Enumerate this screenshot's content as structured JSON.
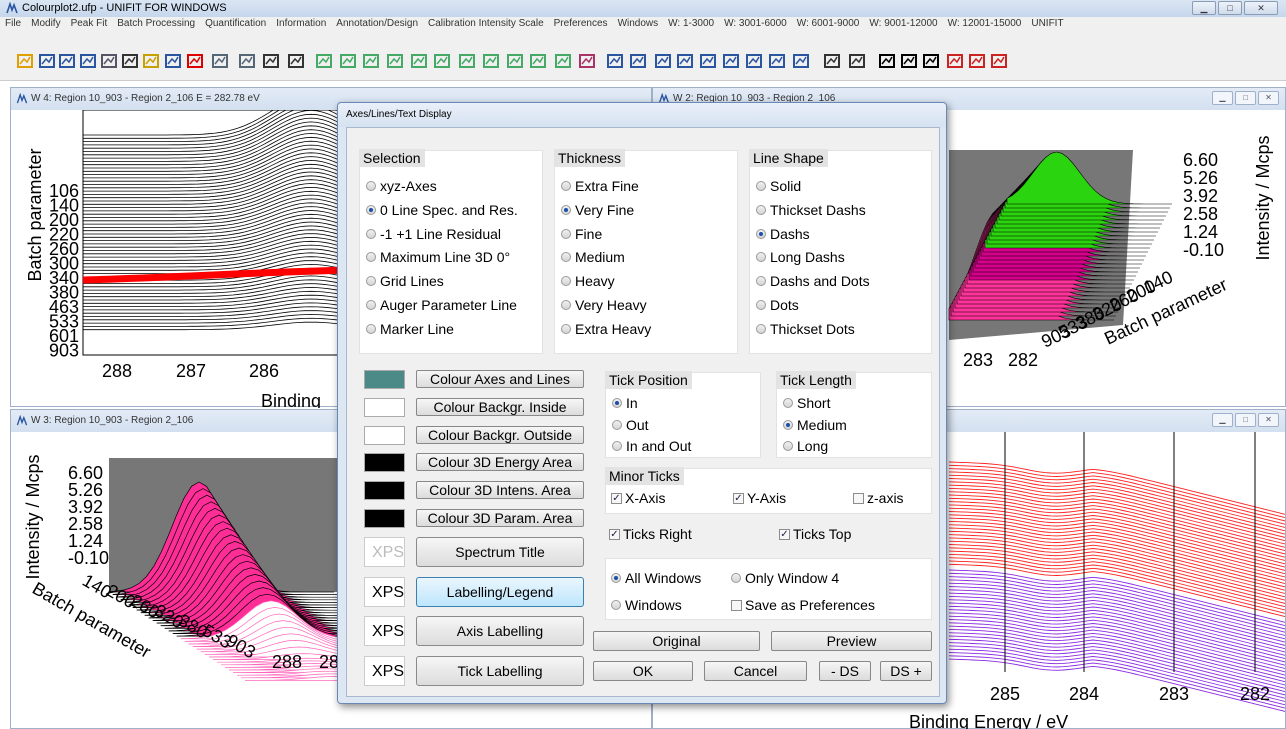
{
  "app": {
    "title": "Colourplot2.ufp - UNIFIT FOR WINDOWS"
  },
  "menu": [
    "File",
    "Modify",
    "Peak Fit",
    "Batch Processing",
    "Quantification",
    "Information",
    "Annotation/Design",
    "Calibration Intensity Scale",
    "Preferences",
    "Windows",
    "W: 1-3000",
    "W: 3001-6000",
    "W: 6001-9000",
    "W: 9001-12000",
    "W: 12001-15000",
    "UNIFIT"
  ],
  "windows": {
    "w4": {
      "title": "W 4: Region 10_903 - Region 2_106  E = 282.78 eV",
      "ylabel": "Batch parameter",
      "xlabel": "Binding",
      "xticks": [
        "288",
        "287",
        "286"
      ],
      "yticks": [
        "106",
        "140",
        "200",
        "220",
        "260",
        "300",
        "340",
        "380",
        "463",
        "533",
        "601",
        "903"
      ]
    },
    "w2": {
      "title": "W 2: Region 10_903 - Region 2_106",
      "ylabel": "Intensity / Mcps",
      "zticks": [
        "6.60",
        "5.26",
        "3.92",
        "2.58",
        "1.24",
        "-0.10"
      ],
      "xticks": [
        "283",
        "282"
      ],
      "bplabel": "Batch parameter",
      "bpticks": [
        "903",
        "533",
        "380",
        "320",
        "260",
        "200",
        "140"
      ]
    },
    "w3": {
      "title": "W 3: Region 10_903 - Region 2_106",
      "ylabel": "Intensity / Mcps",
      "zticks": [
        "6.60",
        "5.26",
        "3.92",
        "2.58",
        "1.24",
        "-0.10"
      ],
      "bplabel": "Batch parameter",
      "bpticks": [
        "140",
        "200",
        "260",
        "320",
        "380",
        "533",
        "903"
      ],
      "xticks": [
        "288",
        "28"
      ]
    },
    "w1": {
      "xlabel": "Binding Energy / eV",
      "xticks": [
        "285",
        "284",
        "283",
        "282"
      ]
    }
  },
  "dialog": {
    "title": "Axes/Lines/Text Display",
    "selection": {
      "header": "Selection",
      "items": [
        "xyz-Axes",
        "0 Line Spec. and Res.",
        "-1 +1 Line Residual",
        "Maximum Line 3D 0°",
        "Grid Lines",
        "Auger Parameter Line",
        "Marker Line"
      ],
      "selected": 1
    },
    "thickness": {
      "header": "Thickness",
      "items": [
        "Extra Fine",
        "Very Fine",
        "Fine",
        "Medium",
        "Heavy",
        "Very Heavy",
        "Extra Heavy"
      ],
      "selected": 1
    },
    "lineshape": {
      "header": "Line Shape",
      "items": [
        "Solid",
        "Thickset Dashs",
        "Dashs",
        "Long Dashs",
        "Dashs and Dots",
        "Dots",
        "Thickset Dots"
      ],
      "selected": 2
    },
    "colours": [
      {
        "label": "Colour Axes and Lines",
        "swatch": "#4b8a86"
      },
      {
        "label": "Colour Backgr. Inside",
        "swatch": "#ffffff"
      },
      {
        "label": "Colour Backgr. Outside",
        "swatch": "#ffffff"
      },
      {
        "label": "Colour 3D Energy Area",
        "swatch": "#000000"
      },
      {
        "label": "Colour 3D Intens. Area",
        "swatch": "#000000"
      },
      {
        "label": "Colour 3D Param. Area",
        "swatch": "#000000"
      }
    ],
    "textbuttons": [
      {
        "preview": "XPS",
        "label": "Spectrum Title",
        "faded": true
      },
      {
        "preview": "XPS",
        "label": "Labelling/Legend",
        "faded": false
      },
      {
        "preview": "XPS",
        "label": "Axis Labelling",
        "faded": false
      },
      {
        "preview": "XPS",
        "label": "Tick Labelling",
        "faded": false
      }
    ],
    "tickpos": {
      "header": "Tick Position",
      "items": [
        "In",
        "Out",
        "In and Out"
      ],
      "selected": 0
    },
    "ticklen": {
      "header": "Tick Length",
      "items": [
        "Short",
        "Medium",
        "Long"
      ],
      "selected": 1
    },
    "minor": {
      "header": "Minor Ticks",
      "x": "X-Axis",
      "y": "Y-Axis",
      "z": "z-axis",
      "x_checked": true,
      "y_checked": true,
      "z_checked": false
    },
    "ticks_right": "Ticks Right",
    "ticks_top": "Ticks Top",
    "apply": {
      "all": "All Windows",
      "only": "Only Window  4",
      "windows": "Windows",
      "save": "Save as Preferences"
    },
    "buttons": {
      "original": "Original",
      "preview": "Preview",
      "ok": "OK",
      "cancel": "Cancel",
      "dsminus": "- DS",
      "dsplus": "DS +"
    }
  }
}
